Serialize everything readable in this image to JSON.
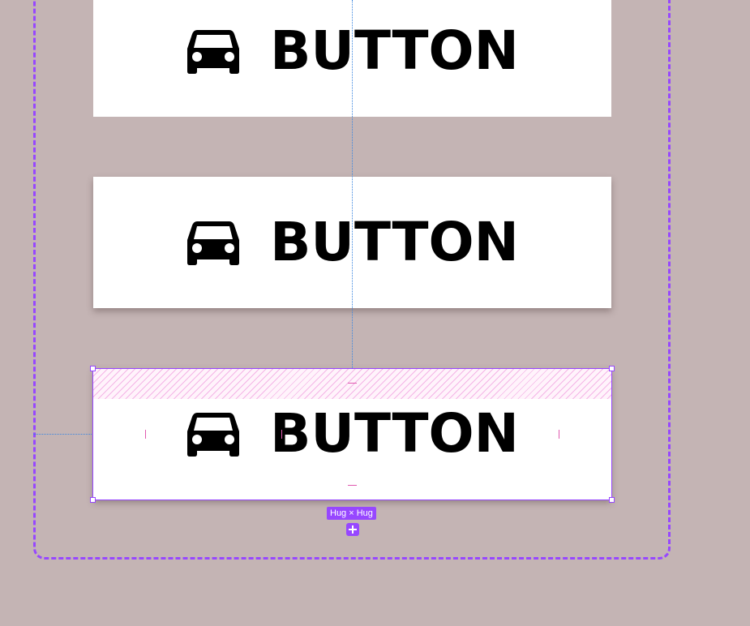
{
  "canvas": {
    "background": "#c4b4b4",
    "frame_outline_color": "#9747ff"
  },
  "buttons": [
    {
      "label": "BUTTON",
      "icon": "car-icon",
      "state": "default"
    },
    {
      "label": "BUTTON",
      "icon": "car-icon",
      "state": "elevated"
    },
    {
      "label": "BUTTON",
      "icon": "car-icon",
      "state": "selected"
    }
  ],
  "selection": {
    "size_label": "Hug × Hug",
    "color": "#9747ff",
    "padding_color": "#e05ab0"
  },
  "guides": {
    "color": "#3b86e0"
  }
}
